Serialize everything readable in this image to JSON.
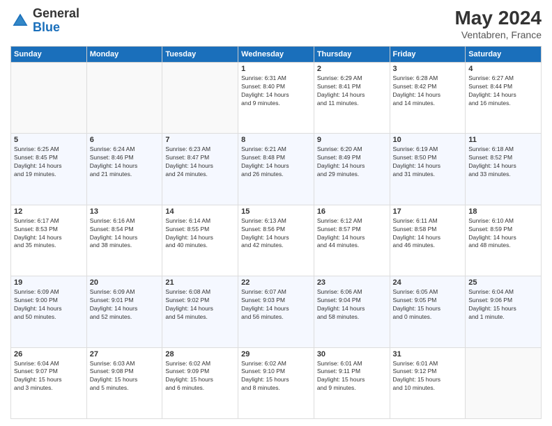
{
  "header": {
    "logo_general": "General",
    "logo_blue": "Blue",
    "month_year": "May 2024",
    "location": "Ventabren, France"
  },
  "weekdays": [
    "Sunday",
    "Monday",
    "Tuesday",
    "Wednesday",
    "Thursday",
    "Friday",
    "Saturday"
  ],
  "weeks": [
    [
      {
        "day": "",
        "info": ""
      },
      {
        "day": "",
        "info": ""
      },
      {
        "day": "",
        "info": ""
      },
      {
        "day": "1",
        "info": "Sunrise: 6:31 AM\nSunset: 8:40 PM\nDaylight: 14 hours\nand 9 minutes."
      },
      {
        "day": "2",
        "info": "Sunrise: 6:29 AM\nSunset: 8:41 PM\nDaylight: 14 hours\nand 11 minutes."
      },
      {
        "day": "3",
        "info": "Sunrise: 6:28 AM\nSunset: 8:42 PM\nDaylight: 14 hours\nand 14 minutes."
      },
      {
        "day": "4",
        "info": "Sunrise: 6:27 AM\nSunset: 8:44 PM\nDaylight: 14 hours\nand 16 minutes."
      }
    ],
    [
      {
        "day": "5",
        "info": "Sunrise: 6:25 AM\nSunset: 8:45 PM\nDaylight: 14 hours\nand 19 minutes."
      },
      {
        "day": "6",
        "info": "Sunrise: 6:24 AM\nSunset: 8:46 PM\nDaylight: 14 hours\nand 21 minutes."
      },
      {
        "day": "7",
        "info": "Sunrise: 6:23 AM\nSunset: 8:47 PM\nDaylight: 14 hours\nand 24 minutes."
      },
      {
        "day": "8",
        "info": "Sunrise: 6:21 AM\nSunset: 8:48 PM\nDaylight: 14 hours\nand 26 minutes."
      },
      {
        "day": "9",
        "info": "Sunrise: 6:20 AM\nSunset: 8:49 PM\nDaylight: 14 hours\nand 29 minutes."
      },
      {
        "day": "10",
        "info": "Sunrise: 6:19 AM\nSunset: 8:50 PM\nDaylight: 14 hours\nand 31 minutes."
      },
      {
        "day": "11",
        "info": "Sunrise: 6:18 AM\nSunset: 8:52 PM\nDaylight: 14 hours\nand 33 minutes."
      }
    ],
    [
      {
        "day": "12",
        "info": "Sunrise: 6:17 AM\nSunset: 8:53 PM\nDaylight: 14 hours\nand 35 minutes."
      },
      {
        "day": "13",
        "info": "Sunrise: 6:16 AM\nSunset: 8:54 PM\nDaylight: 14 hours\nand 38 minutes."
      },
      {
        "day": "14",
        "info": "Sunrise: 6:14 AM\nSunset: 8:55 PM\nDaylight: 14 hours\nand 40 minutes."
      },
      {
        "day": "15",
        "info": "Sunrise: 6:13 AM\nSunset: 8:56 PM\nDaylight: 14 hours\nand 42 minutes."
      },
      {
        "day": "16",
        "info": "Sunrise: 6:12 AM\nSunset: 8:57 PM\nDaylight: 14 hours\nand 44 minutes."
      },
      {
        "day": "17",
        "info": "Sunrise: 6:11 AM\nSunset: 8:58 PM\nDaylight: 14 hours\nand 46 minutes."
      },
      {
        "day": "18",
        "info": "Sunrise: 6:10 AM\nSunset: 8:59 PM\nDaylight: 14 hours\nand 48 minutes."
      }
    ],
    [
      {
        "day": "19",
        "info": "Sunrise: 6:09 AM\nSunset: 9:00 PM\nDaylight: 14 hours\nand 50 minutes."
      },
      {
        "day": "20",
        "info": "Sunrise: 6:09 AM\nSunset: 9:01 PM\nDaylight: 14 hours\nand 52 minutes."
      },
      {
        "day": "21",
        "info": "Sunrise: 6:08 AM\nSunset: 9:02 PM\nDaylight: 14 hours\nand 54 minutes."
      },
      {
        "day": "22",
        "info": "Sunrise: 6:07 AM\nSunset: 9:03 PM\nDaylight: 14 hours\nand 56 minutes."
      },
      {
        "day": "23",
        "info": "Sunrise: 6:06 AM\nSunset: 9:04 PM\nDaylight: 14 hours\nand 58 minutes."
      },
      {
        "day": "24",
        "info": "Sunrise: 6:05 AM\nSunset: 9:05 PM\nDaylight: 15 hours\nand 0 minutes."
      },
      {
        "day": "25",
        "info": "Sunrise: 6:04 AM\nSunset: 9:06 PM\nDaylight: 15 hours\nand 1 minute."
      }
    ],
    [
      {
        "day": "26",
        "info": "Sunrise: 6:04 AM\nSunset: 9:07 PM\nDaylight: 15 hours\nand 3 minutes."
      },
      {
        "day": "27",
        "info": "Sunrise: 6:03 AM\nSunset: 9:08 PM\nDaylight: 15 hours\nand 5 minutes."
      },
      {
        "day": "28",
        "info": "Sunrise: 6:02 AM\nSunset: 9:09 PM\nDaylight: 15 hours\nand 6 minutes."
      },
      {
        "day": "29",
        "info": "Sunrise: 6:02 AM\nSunset: 9:10 PM\nDaylight: 15 hours\nand 8 minutes."
      },
      {
        "day": "30",
        "info": "Sunrise: 6:01 AM\nSunset: 9:11 PM\nDaylight: 15 hours\nand 9 minutes."
      },
      {
        "day": "31",
        "info": "Sunrise: 6:01 AM\nSunset: 9:12 PM\nDaylight: 15 hours\nand 10 minutes."
      },
      {
        "day": "",
        "info": ""
      }
    ]
  ]
}
